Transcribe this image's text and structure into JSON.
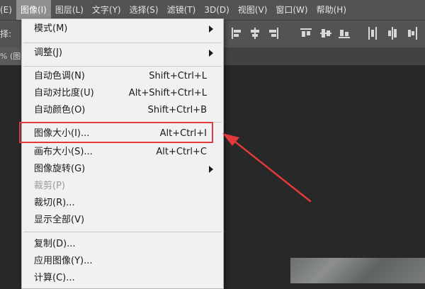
{
  "menubar": {
    "items": [
      {
        "label": "(E)"
      },
      {
        "label": "图像(I)"
      },
      {
        "label": "图层(L)"
      },
      {
        "label": "文字(Y)"
      },
      {
        "label": "选择(S)"
      },
      {
        "label": "滤镜(T)"
      },
      {
        "label": "3D(D)"
      },
      {
        "label": "视图(V)"
      },
      {
        "label": "窗口(W)"
      },
      {
        "label": "帮助(H)"
      }
    ]
  },
  "optionsbar": {
    "label": "择:"
  },
  "tabbar": {
    "tab_label": "% (图"
  },
  "menu": {
    "items": [
      {
        "label": "模式(M)",
        "shortcut": "",
        "submenu": true
      },
      {
        "label": "调整(J)",
        "shortcut": "",
        "submenu": true
      },
      {
        "label": "自动色调(N)",
        "shortcut": "Shift+Ctrl+L"
      },
      {
        "label": "自动对比度(U)",
        "shortcut": "Alt+Shift+Ctrl+L"
      },
      {
        "label": "自动颜色(O)",
        "shortcut": "Shift+Ctrl+B"
      },
      {
        "label": "图像大小(I)...",
        "shortcut": "Alt+Ctrl+I"
      },
      {
        "label": "画布大小(S)...",
        "shortcut": "Alt+Ctrl+C"
      },
      {
        "label": "图像旋转(G)",
        "shortcut": "",
        "submenu": true
      },
      {
        "label": "裁剪(P)",
        "shortcut": "",
        "disabled": true
      },
      {
        "label": "裁切(R)...",
        "shortcut": ""
      },
      {
        "label": "显示全部(V)",
        "shortcut": ""
      },
      {
        "label": "复制(D)...",
        "shortcut": ""
      },
      {
        "label": "应用图像(Y)...",
        "shortcut": ""
      },
      {
        "label": "计算(C)...",
        "shortcut": ""
      }
    ]
  },
  "colors": {
    "menubar_bg": "#535353",
    "menu_bg": "#f1f1f1",
    "highlight": "#e23a3a",
    "canvas_bg": "#282828"
  },
  "icons": [
    "align-left-icon",
    "align-center-icon",
    "align-right-icon",
    "distribute-icon",
    "submenu-arrow-icon",
    "annotation-arrow-icon"
  ]
}
